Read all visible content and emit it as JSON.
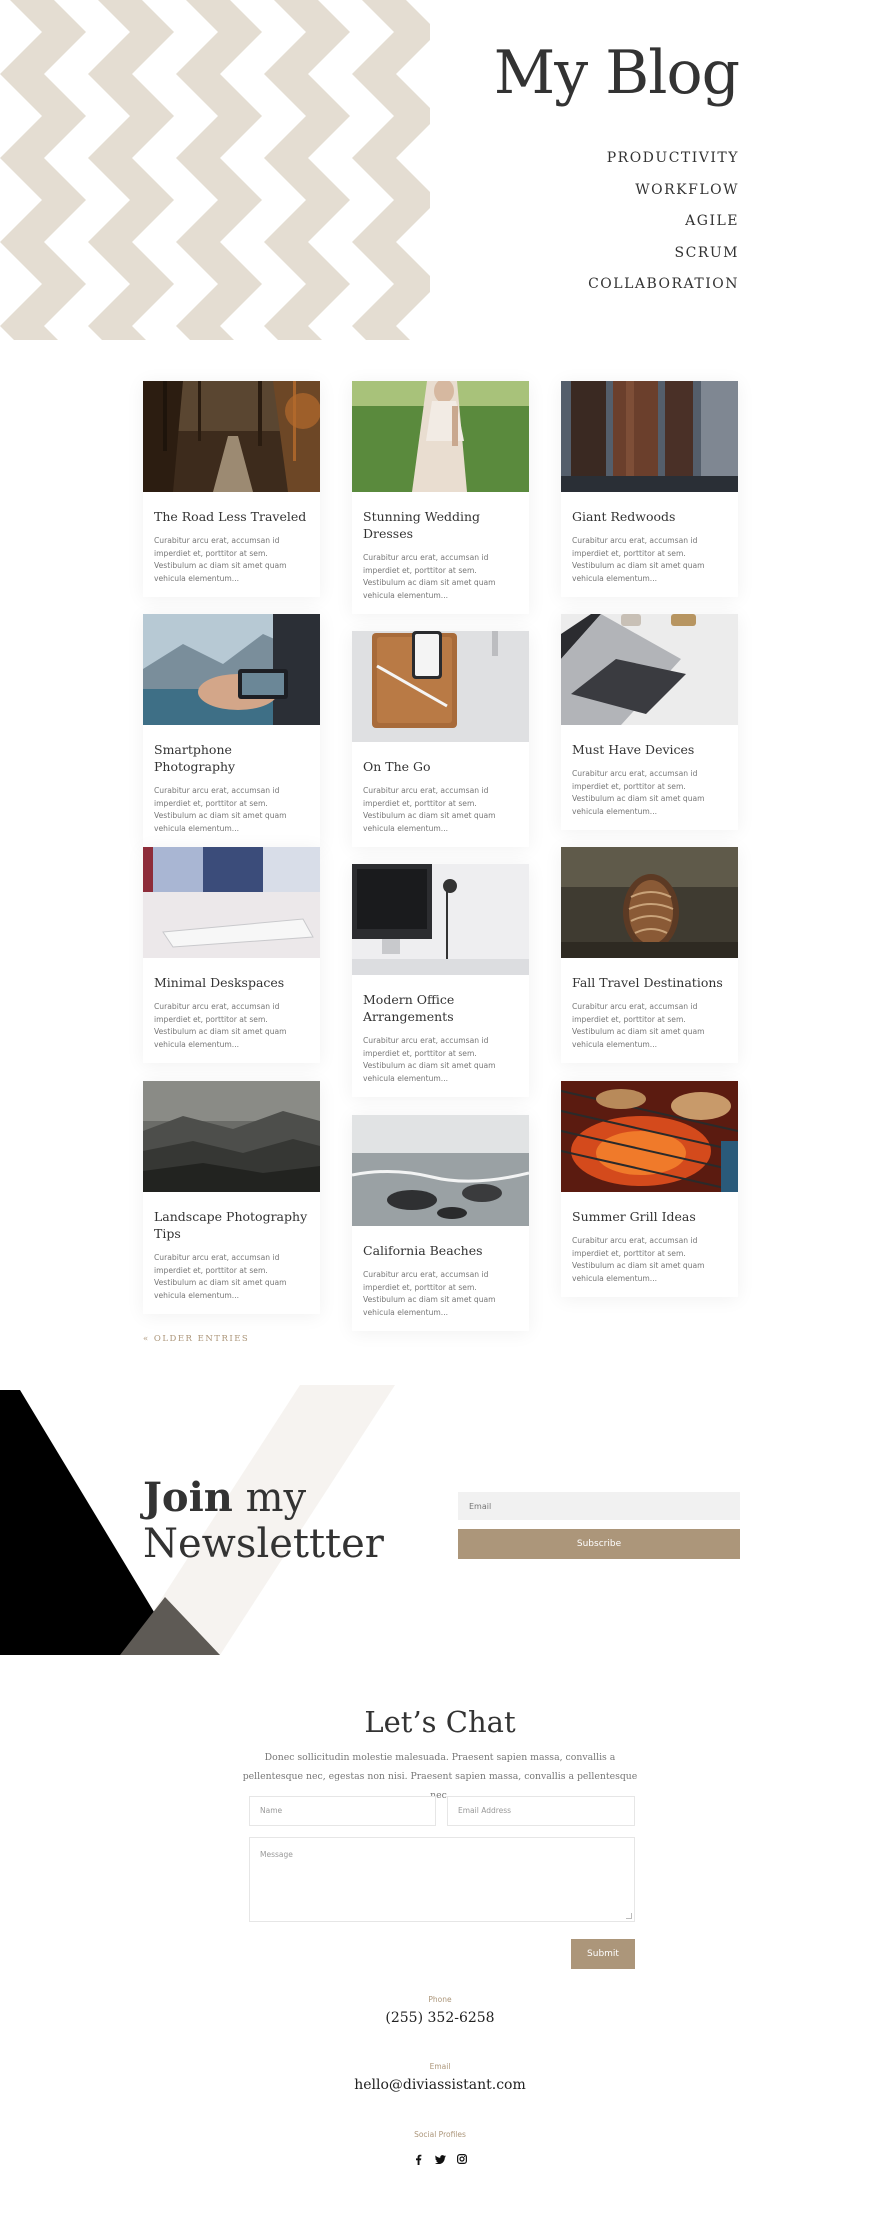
{
  "header": {
    "title": "My Blog",
    "nav": [
      "PRODUCTIVITY",
      "WORKFLOW",
      "AGILE",
      "SCRUM",
      "COLLABORATION"
    ]
  },
  "posts": [
    {
      "title": "The Road Less Traveled",
      "excerpt": "Curabitur arcu erat, accumsan id imperdiet et, porttitor at sem. Vestibulum ac diam sit amet quam vehicula elementum...",
      "image": "forest-road"
    },
    {
      "title": "Stunning Wedding Dresses",
      "excerpt": "Curabitur arcu erat, accumsan id imperdiet et, porttitor at sem. Vestibulum ac diam sit amet quam vehicula elementum...",
      "image": "wedding-dress"
    },
    {
      "title": "Giant Redwoods",
      "excerpt": "Curabitur arcu erat, accumsan id imperdiet et, porttitor at sem. Vestibulum ac diam sit amet quam vehicula elementum...",
      "image": "redwoods"
    },
    {
      "title": "Smartphone Photography",
      "excerpt": "Curabitur arcu erat, accumsan id imperdiet et, porttitor at sem. Vestibulum ac diam sit amet quam vehicula elementum...",
      "image": "smartphone-mountains"
    },
    {
      "title": "On The Go",
      "excerpt": "Curabitur arcu erat, accumsan id imperdiet et, porttitor at sem. Vestibulum ac diam sit amet quam vehicula elementum...",
      "image": "phone-leather-case"
    },
    {
      "title": "Must Have Devices",
      "excerpt": "Curabitur arcu erat, accumsan id imperdiet et, porttitor at sem. Vestibulum ac diam sit amet quam vehicula elementum...",
      "image": "laptop-keyboard"
    },
    {
      "title": "Minimal Deskspaces",
      "excerpt": "Curabitur arcu erat, accumsan id imperdiet et, porttitor at sem. Vestibulum ac diam sit amet quam vehicula elementum...",
      "image": "white-keyboard"
    },
    {
      "title": "Modern Office Arrangements",
      "excerpt": "Curabitur arcu erat, accumsan id imperdiet et, porttitor at sem. Vestibulum ac diam sit amet quam vehicula elementum...",
      "image": "office-monitor-lamp"
    },
    {
      "title": "Fall Travel Destinations",
      "excerpt": "Curabitur arcu erat, accumsan id imperdiet et, porttitor at sem. Vestibulum ac diam sit amet quam vehicula elementum...",
      "image": "pinecone"
    },
    {
      "title": "Landscape Photography Tips",
      "excerpt": "Curabitur arcu erat, accumsan id imperdiet et, porttitor at sem. Vestibulum ac diam sit amet quam vehicula elementum...",
      "image": "misty-hills"
    },
    {
      "title": "California Beaches",
      "excerpt": "Curabitur arcu erat, accumsan id imperdiet et, porttitor at sem. Vestibulum ac diam sit amet quam vehicula elementum...",
      "image": "rocky-beach"
    },
    {
      "title": "Summer Grill Ideas",
      "excerpt": "Curabitur arcu erat, accumsan id imperdiet et, porttitor at sem. Vestibulum ac diam sit amet quam vehicula elementum...",
      "image": "grill"
    }
  ],
  "pagination": {
    "older": "« OLDER ENTRIES"
  },
  "newsletter": {
    "title_bold": "Join",
    "title_rest": " my",
    "title_line2": "Newslettter",
    "email_placeholder": "Email",
    "button": "Subscribe"
  },
  "contact": {
    "title": "Let’s Chat",
    "description": "Donec sollicitudin molestie malesuada. Praesent sapien massa, convallis a pellentesque nec, egestas non nisi. Praesent sapien massa, convallis a pellentesque nec.",
    "name_placeholder": "Name",
    "email_placeholder": "Email Address",
    "message_placeholder": "Message",
    "submit": "Submit",
    "phone_label": "Phone",
    "phone": "(255) 352-6258",
    "email_label": "Email",
    "email": "hello@diviassistant.com",
    "social_label": "Social Profiles",
    "social": [
      "facebook-icon",
      "twitter-icon",
      "instagram-icon"
    ]
  },
  "colors": {
    "accent": "#ac967a",
    "chevron": "#e4ddd2",
    "text": "#333333"
  }
}
